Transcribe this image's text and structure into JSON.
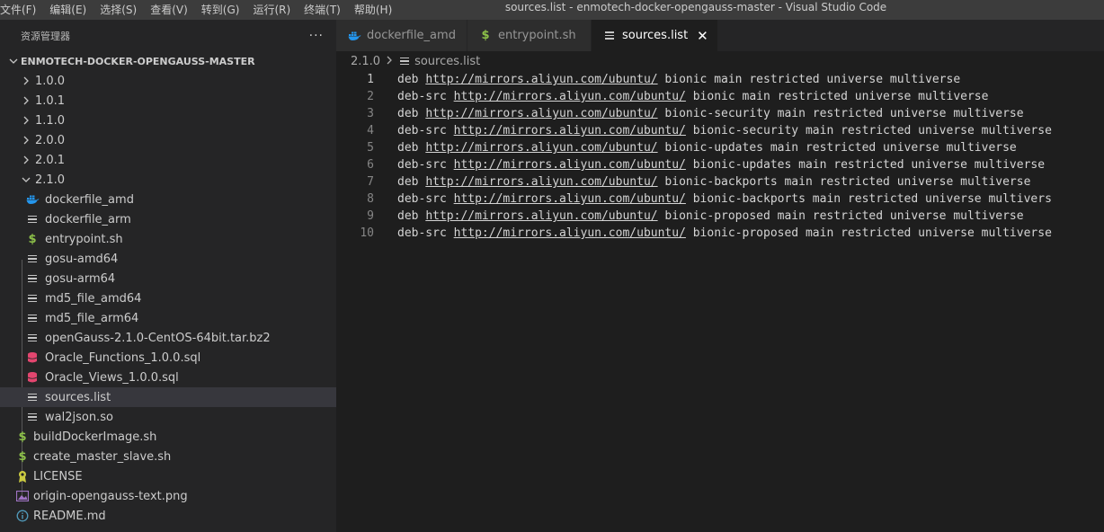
{
  "menu": [
    "文件(F)",
    "编辑(E)",
    "选择(S)",
    "查看(V)",
    "转到(G)",
    "运行(R)",
    "终端(T)",
    "帮助(H)"
  ],
  "window_title": "sources.list - enmotech-docker-opengauss-master - Visual Studio Code",
  "sidebar": {
    "title": "资源管理器",
    "more": "···",
    "project": "ENMOTECH-DOCKER-OPENGAUSS-MASTER",
    "folders_collapsed": [
      "1.0.0",
      "1.0.1",
      "1.1.0",
      "2.0.0",
      "2.0.1"
    ],
    "folder_open": "2.1.0",
    "children": [
      {
        "name": "dockerfile_amd",
        "icon": "docker-icon"
      },
      {
        "name": "dockerfile_arm",
        "icon": "lines-icon"
      },
      {
        "name": "entrypoint.sh",
        "icon": "dollar-icon"
      },
      {
        "name": "gosu-amd64",
        "icon": "lines-icon"
      },
      {
        "name": "gosu-arm64",
        "icon": "lines-icon"
      },
      {
        "name": "md5_file_amd64",
        "icon": "lines-icon"
      },
      {
        "name": "md5_file_arm64",
        "icon": "lines-icon"
      },
      {
        "name": "openGauss-2.1.0-CentOS-64bit.tar.bz2",
        "icon": "lines-icon"
      },
      {
        "name": "Oracle_Functions_1.0.0.sql",
        "icon": "database-icon"
      },
      {
        "name": "Oracle_Views_1.0.0.sql",
        "icon": "database-icon"
      },
      {
        "name": "sources.list",
        "icon": "lines-icon",
        "selected": true
      },
      {
        "name": "wal2json.so",
        "icon": "lines-icon"
      }
    ],
    "root_files": [
      {
        "name": "buildDockerImage.sh",
        "icon": "dollar-icon"
      },
      {
        "name": "create_master_slave.sh",
        "icon": "dollar-icon"
      },
      {
        "name": "LICENSE",
        "icon": "license-icon"
      },
      {
        "name": "origin-opengauss-text.png",
        "icon": "image-icon"
      },
      {
        "name": "README.md",
        "icon": "info-icon"
      }
    ]
  },
  "tabs": [
    {
      "label": "dockerfile_amd",
      "icon": "docker-icon",
      "active": false
    },
    {
      "label": "entrypoint.sh",
      "icon": "dollar-icon",
      "active": false
    },
    {
      "label": "sources.list",
      "icon": "lines-icon",
      "active": true,
      "close": "✕"
    }
  ],
  "breadcrumb": {
    "folder": "2.1.0",
    "file": "sources.list"
  },
  "code_lines": [
    {
      "n": "1",
      "pre": "deb ",
      "url": "http://mirrors.aliyun.com/ubuntu/",
      "post": " bionic main restricted universe multiverse"
    },
    {
      "n": "2",
      "pre": "deb-src ",
      "url": "http://mirrors.aliyun.com/ubuntu/",
      "post": " bionic main restricted universe multiverse"
    },
    {
      "n": "3",
      "pre": "deb ",
      "url": "http://mirrors.aliyun.com/ubuntu/",
      "post": " bionic-security main restricted universe multiverse"
    },
    {
      "n": "4",
      "pre": "deb-src ",
      "url": "http://mirrors.aliyun.com/ubuntu/",
      "post": " bionic-security main restricted universe multiverse"
    },
    {
      "n": "5",
      "pre": "deb ",
      "url": "http://mirrors.aliyun.com/ubuntu/",
      "post": " bionic-updates main restricted universe multiverse"
    },
    {
      "n": "6",
      "pre": "deb-src ",
      "url": "http://mirrors.aliyun.com/ubuntu/",
      "post": " bionic-updates main restricted universe multiverse"
    },
    {
      "n": "7",
      "pre": "deb ",
      "url": "http://mirrors.aliyun.com/ubuntu/",
      "post": " bionic-backports main restricted universe multiverse"
    },
    {
      "n": "8",
      "pre": "deb-src ",
      "url": "http://mirrors.aliyun.com/ubuntu/",
      "post": " bionic-backports main restricted universe multivers"
    },
    {
      "n": "9",
      "pre": "deb ",
      "url": "http://mirrors.aliyun.com/ubuntu/",
      "post": " bionic-proposed main restricted universe multiverse"
    },
    {
      "n": "10",
      "pre": "deb-src ",
      "url": "http://mirrors.aliyun.com/ubuntu/",
      "post": " bionic-proposed main restricted universe multiverse"
    }
  ],
  "current_line": "1",
  "colors": {
    "accent": "#8dc149",
    "docker": "#2496ed",
    "database": "#e3466f",
    "license": "#cbcb41",
    "image": "#a074c4",
    "info": "#519aba"
  }
}
